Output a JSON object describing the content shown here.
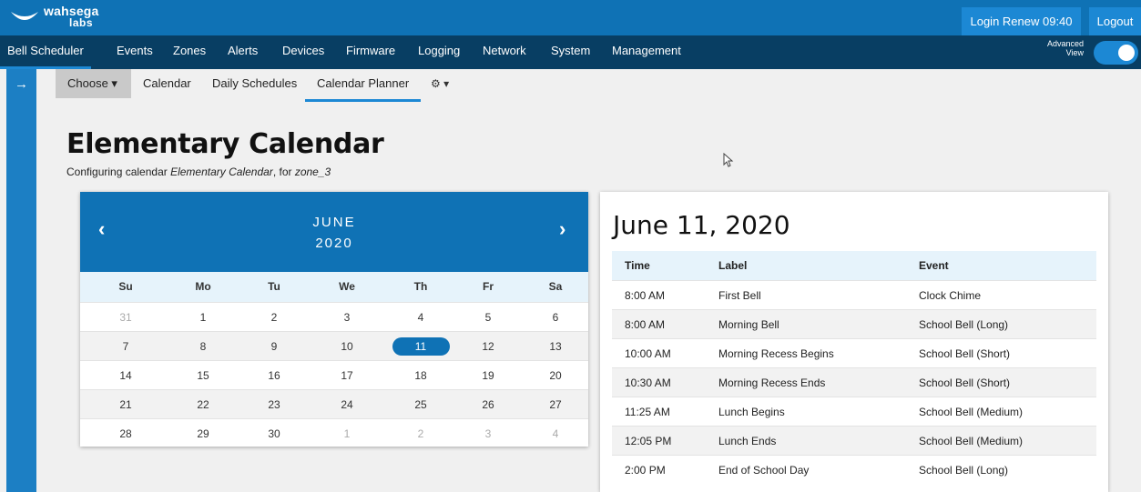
{
  "brand": {
    "line1": "wahsega",
    "line2": "labs"
  },
  "topbar": {
    "login_renew": "Login Renew 09:40",
    "logout": "Logout"
  },
  "nav": {
    "items": [
      "Bell Scheduler",
      "Events",
      "Zones",
      "Alerts",
      "Devices",
      "Firmware",
      "Logging",
      "Network",
      "System",
      "Management"
    ],
    "active": "Bell Scheduler",
    "advanced_view_label_1": "Advanced",
    "advanced_view_label_2": "View",
    "advanced_view_on": true
  },
  "subnav": {
    "choose": "Choose ▾",
    "items": [
      "Calendar",
      "Daily Schedules",
      "Calendar Planner"
    ],
    "active": "Calendar Planner",
    "gear": "⚙ ▾"
  },
  "page": {
    "title": "Elementary Calendar",
    "subtitle_prefix": "Configuring calendar ",
    "calendar_name": "Elementary Calendar",
    "subtitle_mid": ", for ",
    "zone": "zone_3"
  },
  "calendar": {
    "prev": "‹",
    "next": "›",
    "month": "JUNE",
    "year": "2020",
    "weekdays": [
      "Su",
      "Mo",
      "Tu",
      "We",
      "Th",
      "Fr",
      "Sa"
    ],
    "weeks": [
      [
        {
          "d": "31",
          "m": true
        },
        {
          "d": "1"
        },
        {
          "d": "2"
        },
        {
          "d": "3"
        },
        {
          "d": "4"
        },
        {
          "d": "5"
        },
        {
          "d": "6"
        }
      ],
      [
        {
          "d": "7"
        },
        {
          "d": "8"
        },
        {
          "d": "9"
        },
        {
          "d": "10"
        },
        {
          "d": "11",
          "s": true
        },
        {
          "d": "12"
        },
        {
          "d": "13"
        }
      ],
      [
        {
          "d": "14"
        },
        {
          "d": "15"
        },
        {
          "d": "16"
        },
        {
          "d": "17"
        },
        {
          "d": "18"
        },
        {
          "d": "19"
        },
        {
          "d": "20"
        }
      ],
      [
        {
          "d": "21"
        },
        {
          "d": "22"
        },
        {
          "d": "23"
        },
        {
          "d": "24"
        },
        {
          "d": "25"
        },
        {
          "d": "26"
        },
        {
          "d": "27"
        }
      ],
      [
        {
          "d": "28"
        },
        {
          "d": "29"
        },
        {
          "d": "30"
        },
        {
          "d": "1",
          "m": true
        },
        {
          "d": "2",
          "m": true
        },
        {
          "d": "3",
          "m": true
        },
        {
          "d": "4",
          "m": true
        }
      ]
    ]
  },
  "day": {
    "title": "June 11, 2020",
    "columns": [
      "Time",
      "Label",
      "Event"
    ],
    "rows": [
      [
        "8:00 AM",
        "First Bell",
        "Clock Chime"
      ],
      [
        "8:00 AM",
        "Morning Bell",
        "School Bell (Long)"
      ],
      [
        "10:00 AM",
        "Morning Recess Begins",
        "School Bell (Short)"
      ],
      [
        "10:30 AM",
        "Morning Recess Ends",
        "School Bell (Short)"
      ],
      [
        "11:25 AM",
        "Lunch Begins",
        "School Bell (Medium)"
      ],
      [
        "12:05 PM",
        "Lunch Ends",
        "School Bell (Medium)"
      ],
      [
        "2:00 PM",
        "End of School Day",
        "School Bell (Long)"
      ]
    ]
  },
  "colors": {
    "primary": "#0f72b5",
    "nav_dark": "#083e63",
    "accent": "#1c88d4",
    "header_row": "#e6f3fb"
  }
}
